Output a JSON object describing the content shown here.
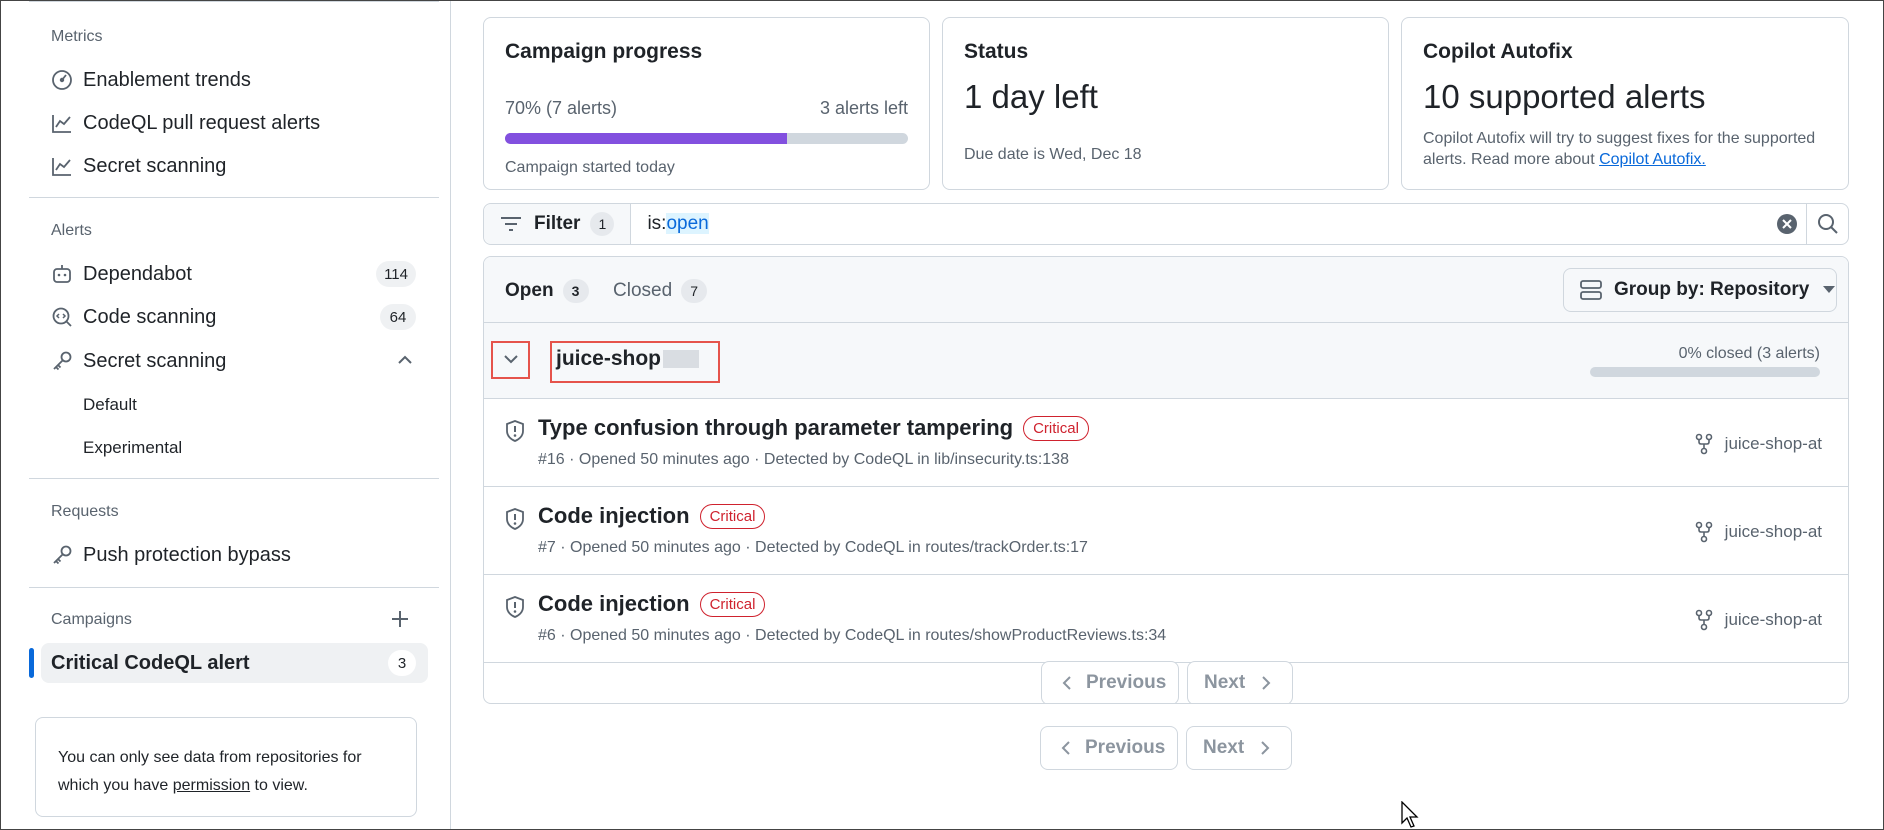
{
  "sidebar": {
    "metrics": {
      "title": "Metrics",
      "items": [
        {
          "label": "Enablement trends",
          "icon": "gauge-icon"
        },
        {
          "label": "CodeQL pull request alerts",
          "icon": "graph-icon"
        },
        {
          "label": "Secret scanning",
          "icon": "graph-icon"
        }
      ]
    },
    "alerts": {
      "title": "Alerts",
      "items": [
        {
          "label": "Dependabot",
          "count": "114",
          "icon": "dependabot-icon"
        },
        {
          "label": "Code scanning",
          "count": "64",
          "icon": "codescan-icon"
        },
        {
          "label": "Secret scanning",
          "icon": "key-icon",
          "expanded": true
        }
      ],
      "sub_items": [
        "Default",
        "Experimental"
      ]
    },
    "requests": {
      "title": "Requests",
      "items": [
        {
          "label": "Push protection bypass",
          "icon": "key-icon"
        }
      ]
    },
    "campaigns": {
      "title": "Campaigns",
      "items": [
        {
          "label": "Critical CodeQL alert",
          "count": "3",
          "active": true
        }
      ]
    },
    "info": {
      "text_before": "You can only see data from repositories for which you have ",
      "link": "permission",
      "text_after": " to view."
    }
  },
  "cards": {
    "progress": {
      "title": "Campaign progress",
      "percent_text": "70% (7 alerts)",
      "left_text": "3 alerts left",
      "progress_value": 0.7,
      "started": "Campaign started today"
    },
    "status": {
      "title": "Status",
      "big": "1 day left",
      "due": "Due date is Wed, Dec 18"
    },
    "autofix": {
      "title": "Copilot Autofix",
      "big": "10 supported alerts",
      "desc": "Copilot Autofix will try to suggest fixes for the supported alerts. Read more about ",
      "link": "Copilot Autofix."
    }
  },
  "filter": {
    "label": "Filter",
    "count": "1",
    "query_key": "is:",
    "query_value": "open"
  },
  "tabs": {
    "open": {
      "label": "Open",
      "count": "3"
    },
    "closed": {
      "label": "Closed",
      "count": "7"
    }
  },
  "group_by": "Group by: Repository",
  "repo_group": {
    "name": "juice-shop",
    "closed_text": "0% closed (3 alerts)",
    "closed_value": 0
  },
  "alerts": [
    {
      "title": "Type confusion through parameter tampering",
      "severity": "Critical",
      "meta": "#16 · Opened 50 minutes ago · Detected by CodeQL in lib/insecurity.ts:138",
      "repo": "juice-shop-at"
    },
    {
      "title": "Code injection",
      "severity": "Critical",
      "meta": "#7 · Opened 50 minutes ago · Detected by CodeQL in routes/trackOrder.ts:17",
      "repo": "juice-shop-at"
    },
    {
      "title": "Code injection",
      "severity": "Critical",
      "meta": "#6 · Opened 50 minutes ago · Detected by CodeQL in routes/showProductReviews.ts:34",
      "repo": "juice-shop-at"
    }
  ],
  "pagination": {
    "previous": "Previous",
    "next": "Next"
  },
  "colors": {
    "accent": "#0969da",
    "progress": "#8250df",
    "critical": "#cf222e",
    "highlight_box": "#e5534b"
  }
}
